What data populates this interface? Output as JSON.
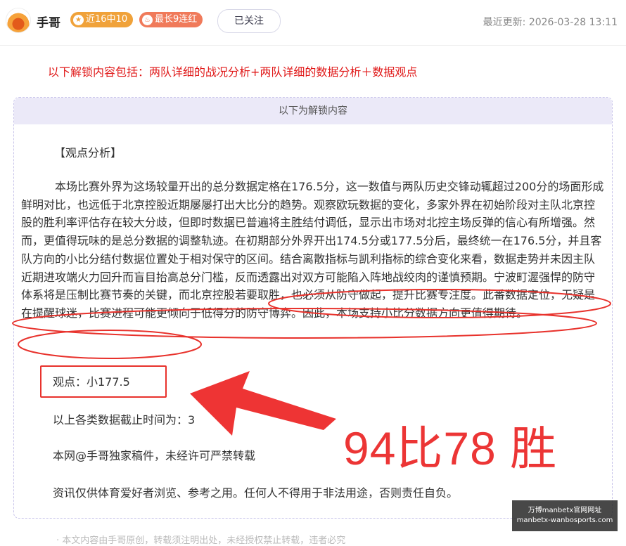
{
  "header": {
    "author": "手哥",
    "badge_recent": "近16中10",
    "badge_streak": "最长9连红",
    "follow_label": "已关注",
    "update_label": "最近更新: 2026-03-28 13:11"
  },
  "intro": "以下解锁内容包括：两队详细的战况分析+两队详细的数据分析＋数据观点",
  "unlock": {
    "header": "以下为解锁内容",
    "section_title": "【观点分析】",
    "paragraph": "本场比赛外界为这场较量开出的总分数据定格在176.5分，这一数值与两队历史交锋动辄超过200分的场面形成鲜明对比，也远低于北京控股近期屡屡打出大比分的趋势。观察欧玩数据的变化，多家外界在初始阶段对主队北京控股的胜利率评估存在较大分歧，但即时数据已普遍将主胜结付调低，显示出市场对北控主场反弹的信心有所增强。然而，更值得玩味的是总分数据的调整轨迹。在初期部分外界开出174.5分或177.5分后，最终统一在176.5分，并且客队方向的小比分结付数据位置处于相对保守的区间。结合离散指标与凯利指标的综合变化来看，数据走势并未因主队近期进攻端火力回升而盲目抬高总分门槛，反而透露出对双方可能陷入阵地战绞肉的谨慎预期。宁波町渥强悍的防守体系将是压制比赛节奏的关键，而北京控股若要取胜，也必须从防守做起，提升比赛专注度。此番数据定位，无疑是在提醒球迷，比赛进程可能更倾向于低得分的防守博弈。因此，本场支持小比分数据方向更值得期待。",
    "view": "观点：小177.5",
    "cutoff": "以上各类数据截止时间为：3",
    "copyright": "本网@手哥独家稿件，未经许可严禁转载",
    "disclaimer": "资讯仅供体育爱好者浏览、参考之用。任何人不得用于非法用途，否则责任自负。"
  },
  "overlay": {
    "big_text": "94比78 胜",
    "watermark_line1": "万博manbetx官网网址",
    "watermark_line2": "manbetx-wanbosports.com"
  },
  "footer_text": "· 本文内容由手哥原创，转载须注明出处，未经授权禁止转载，违者必究"
}
